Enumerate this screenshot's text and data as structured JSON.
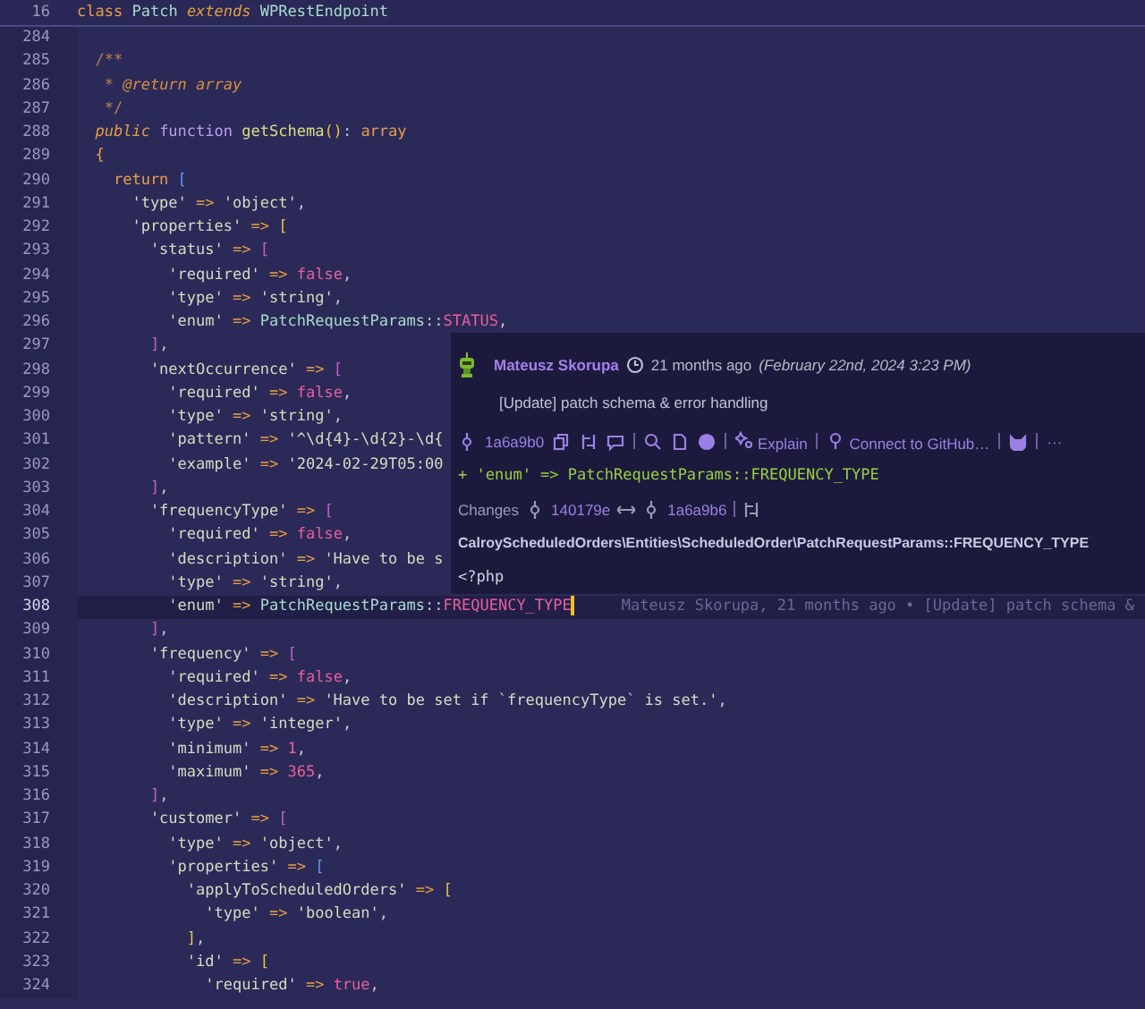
{
  "editor": {
    "sticky_line": {
      "number": "16",
      "tokens": [
        {
          "kind": "keyword",
          "text": "class "
        },
        {
          "kind": "class-name",
          "text": "Patch "
        },
        {
          "kind": "modifier",
          "text": "extends "
        },
        {
          "kind": "class-name",
          "text": "WPRestEndpoint"
        }
      ]
    },
    "lines": [
      {
        "number": "284",
        "current": false
      },
      {
        "number": "285",
        "current": false,
        "tokens": [
          {
            "kind": "comment",
            "text": "  /**"
          }
        ]
      },
      {
        "number": "286",
        "current": false,
        "tokens": [
          {
            "kind": "comment",
            "text": "   * "
          },
          {
            "kind": "doc-tag",
            "text": "@return array"
          }
        ]
      },
      {
        "number": "287",
        "current": false,
        "tokens": [
          {
            "kind": "comment",
            "text": "   */"
          }
        ]
      },
      {
        "number": "288",
        "current": false,
        "tokens": [
          {
            "kind": "modifier",
            "text": "  public "
          },
          {
            "kind": "function-keyword",
            "text": "function "
          },
          {
            "kind": "method",
            "text": "getSchema"
          },
          {
            "kind": "bracket",
            "color": "#e8c040",
            "text": "()"
          },
          {
            "kind": "punctuation",
            "text": ": "
          },
          {
            "kind": "keyword",
            "text": "array"
          }
        ]
      },
      {
        "number": "289",
        "current": false,
        "tokens": [
          {
            "kind": "bracket",
            "color": "#e8a040",
            "text": "  {"
          }
        ]
      },
      {
        "number": "290",
        "current": false,
        "tokens": [
          {
            "kind": "keyword",
            "text": "    return "
          },
          {
            "kind": "bracket",
            "color": "#5a9af0",
            "text": "["
          }
        ]
      },
      {
        "number": "291",
        "current": false,
        "tokens": [
          {
            "kind": "string",
            "text": "      'type'"
          },
          {
            "kind": "operator",
            "text": " => "
          },
          {
            "kind": "string",
            "text": "'object'"
          },
          {
            "kind": "punctuation",
            "text": ","
          }
        ]
      },
      {
        "number": "292",
        "current": false,
        "tokens": [
          {
            "kind": "string",
            "text": "      'properties'"
          },
          {
            "kind": "operator",
            "text": " => "
          },
          {
            "kind": "bracket",
            "color": "#e8c040",
            "text": "["
          }
        ]
      },
      {
        "number": "293",
        "current": false,
        "tokens": [
          {
            "kind": "string",
            "text": "        'status'"
          },
          {
            "kind": "operator",
            "text": " => "
          },
          {
            "kind": "bracket",
            "color": "#c060c8",
            "text": "["
          }
        ]
      },
      {
        "number": "294",
        "current": false,
        "tokens": [
          {
            "kind": "string",
            "text": "          'required'"
          },
          {
            "kind": "operator",
            "text": " => "
          },
          {
            "kind": "literal",
            "text": "false"
          },
          {
            "kind": "punctuation",
            "text": ","
          }
        ]
      },
      {
        "number": "295",
        "current": false,
        "tokens": [
          {
            "kind": "string",
            "text": "          'type'"
          },
          {
            "kind": "operator",
            "text": " => "
          },
          {
            "kind": "string",
            "text": "'string'"
          },
          {
            "kind": "punctuation",
            "text": ","
          }
        ]
      },
      {
        "number": "296",
        "current": false,
        "tokens": [
          {
            "kind": "string",
            "text": "          'enum'"
          },
          {
            "kind": "operator",
            "text": " => "
          },
          {
            "kind": "class-name",
            "text": "PatchRequestParams"
          },
          {
            "kind": "punctuation",
            "text": "::"
          },
          {
            "kind": "constant",
            "text": "STATUS"
          },
          {
            "kind": "punctuation",
            "text": ","
          }
        ]
      },
      {
        "number": "297",
        "current": false,
        "tokens": [
          {
            "kind": "bracket",
            "color": "#c060c8",
            "text": "        ]"
          },
          {
            "kind": "punctuation",
            "text": ","
          }
        ]
      },
      {
        "number": "298",
        "current": false,
        "tokens": [
          {
            "kind": "string",
            "text": "        'nextOccurrence'"
          },
          {
            "kind": "operator",
            "text": " => "
          },
          {
            "kind": "bracket",
            "color": "#c060c8",
            "text": "["
          }
        ]
      },
      {
        "number": "299",
        "current": false,
        "tokens": [
          {
            "kind": "string",
            "text": "          'required'"
          },
          {
            "kind": "operator",
            "text": " => "
          },
          {
            "kind": "literal",
            "text": "false"
          },
          {
            "kind": "punctuation",
            "text": ","
          }
        ]
      },
      {
        "number": "300",
        "current": false,
        "tokens": [
          {
            "kind": "string",
            "text": "          'type'"
          },
          {
            "kind": "operator",
            "text": " => "
          },
          {
            "kind": "string",
            "text": "'string'"
          },
          {
            "kind": "punctuation",
            "text": ","
          }
        ]
      },
      {
        "number": "301",
        "current": false,
        "tokens": [
          {
            "kind": "string",
            "text": "          'pattern'"
          },
          {
            "kind": "operator",
            "text": " => "
          },
          {
            "kind": "string",
            "text": "'^\\d{4}-\\d{2}-\\d{"
          }
        ]
      },
      {
        "number": "302",
        "current": false,
        "tokens": [
          {
            "kind": "string",
            "text": "          'example'"
          },
          {
            "kind": "operator",
            "text": " => "
          },
          {
            "kind": "string",
            "text": "'2024-02-29T05:00"
          }
        ]
      },
      {
        "number": "303",
        "current": false,
        "tokens": [
          {
            "kind": "bracket",
            "color": "#c060c8",
            "text": "        ]"
          },
          {
            "kind": "punctuation",
            "text": ","
          }
        ]
      },
      {
        "number": "304",
        "current": false,
        "tokens": [
          {
            "kind": "string",
            "text": "        'frequencyType'"
          },
          {
            "kind": "operator",
            "text": " => "
          },
          {
            "kind": "bracket",
            "color": "#c060c8",
            "text": "["
          }
        ]
      },
      {
        "number": "305",
        "current": false,
        "tokens": [
          {
            "kind": "string",
            "text": "          'required'"
          },
          {
            "kind": "operator",
            "text": " => "
          },
          {
            "kind": "literal",
            "text": "false"
          },
          {
            "kind": "punctuation",
            "text": ","
          }
        ]
      },
      {
        "number": "306",
        "current": false,
        "tokens": [
          {
            "kind": "string",
            "text": "          'description'"
          },
          {
            "kind": "operator",
            "text": " => "
          },
          {
            "kind": "string",
            "text": "'Have to be s"
          }
        ]
      },
      {
        "number": "307",
        "current": false,
        "tokens": [
          {
            "kind": "string",
            "text": "          'type'"
          },
          {
            "kind": "operator",
            "text": " => "
          },
          {
            "kind": "string",
            "text": "'string'"
          },
          {
            "kind": "punctuation",
            "text": ","
          }
        ]
      },
      {
        "number": "308",
        "current": true,
        "tokens": [
          {
            "kind": "string",
            "text": "          'enum'"
          },
          {
            "kind": "operator",
            "text": " => "
          },
          {
            "kind": "class-name",
            "text": "PatchRequestParams"
          },
          {
            "kind": "punctuation",
            "text": "::"
          },
          {
            "kind": "constant",
            "text": "FREQUENCY_TYPE"
          }
        ]
      },
      {
        "number": "309",
        "current": false,
        "tokens": [
          {
            "kind": "bracket",
            "color": "#c060c8",
            "text": "        ]"
          },
          {
            "kind": "punctuation",
            "text": ","
          }
        ]
      },
      {
        "number": "310",
        "current": false,
        "tokens": [
          {
            "kind": "string",
            "text": "        'frequency'"
          },
          {
            "kind": "operator",
            "text": " => "
          },
          {
            "kind": "bracket",
            "color": "#c060c8",
            "text": "["
          }
        ]
      },
      {
        "number": "311",
        "current": false,
        "tokens": [
          {
            "kind": "string",
            "text": "          'required'"
          },
          {
            "kind": "operator",
            "text": " => "
          },
          {
            "kind": "literal",
            "text": "false"
          },
          {
            "kind": "punctuation",
            "text": ","
          }
        ]
      },
      {
        "number": "312",
        "current": false,
        "tokens": [
          {
            "kind": "string",
            "text": "          'description'"
          },
          {
            "kind": "operator",
            "text": " => "
          },
          {
            "kind": "string",
            "text": "'Have to be set if `frequencyType` is set.'"
          },
          {
            "kind": "punctuation",
            "text": ","
          }
        ]
      },
      {
        "number": "313",
        "current": false,
        "tokens": [
          {
            "kind": "string",
            "text": "          'type'"
          },
          {
            "kind": "operator",
            "text": " => "
          },
          {
            "kind": "string",
            "text": "'integer'"
          },
          {
            "kind": "punctuation",
            "text": ","
          }
        ]
      },
      {
        "number": "314",
        "current": false,
        "tokens": [
          {
            "kind": "string",
            "text": "          'minimum'"
          },
          {
            "kind": "operator",
            "text": " => "
          },
          {
            "kind": "literal",
            "text": "1"
          },
          {
            "kind": "punctuation",
            "text": ","
          }
        ]
      },
      {
        "number": "315",
        "current": false,
        "tokens": [
          {
            "kind": "string",
            "text": "          'maximum'"
          },
          {
            "kind": "operator",
            "text": " => "
          },
          {
            "kind": "literal",
            "text": "365"
          },
          {
            "kind": "punctuation",
            "text": ","
          }
        ]
      },
      {
        "number": "316",
        "current": false,
        "tokens": [
          {
            "kind": "bracket",
            "color": "#c060c8",
            "text": "        ]"
          },
          {
            "kind": "punctuation",
            "text": ","
          }
        ]
      },
      {
        "number": "317",
        "current": false,
        "tokens": [
          {
            "kind": "string",
            "text": "        'customer'"
          },
          {
            "kind": "operator",
            "text": " => "
          },
          {
            "kind": "bracket",
            "color": "#c060c8",
            "text": "["
          }
        ]
      },
      {
        "number": "318",
        "current": false,
        "tokens": [
          {
            "kind": "string",
            "text": "          'type'"
          },
          {
            "kind": "operator",
            "text": " => "
          },
          {
            "kind": "string",
            "text": "'object'"
          },
          {
            "kind": "punctuation",
            "text": ","
          }
        ]
      },
      {
        "number": "319",
        "current": false,
        "tokens": [
          {
            "kind": "string",
            "text": "          'properties'"
          },
          {
            "kind": "operator",
            "text": " => "
          },
          {
            "kind": "bracket",
            "color": "#5a9af0",
            "text": "["
          }
        ]
      },
      {
        "number": "320",
        "current": false,
        "tokens": [
          {
            "kind": "string",
            "text": "            'applyToScheduledOrders'"
          },
          {
            "kind": "operator",
            "text": " => "
          },
          {
            "kind": "bracket",
            "color": "#e8c040",
            "text": "["
          }
        ]
      },
      {
        "number": "321",
        "current": false,
        "tokens": [
          {
            "kind": "string",
            "text": "              'type'"
          },
          {
            "kind": "operator",
            "text": " => "
          },
          {
            "kind": "string",
            "text": "'boolean'"
          },
          {
            "kind": "punctuation",
            "text": ","
          }
        ]
      },
      {
        "number": "322",
        "current": false,
        "tokens": [
          {
            "kind": "bracket",
            "color": "#e8c040",
            "text": "            ]"
          },
          {
            "kind": "punctuation",
            "text": ","
          }
        ]
      },
      {
        "number": "323",
        "current": false,
        "tokens": [
          {
            "kind": "string",
            "text": "            'id'"
          },
          {
            "kind": "operator",
            "text": " => "
          },
          {
            "kind": "bracket",
            "color": "#e8c040",
            "text": "["
          }
        ]
      },
      {
        "number": "324",
        "current": false,
        "tokens": [
          {
            "kind": "string",
            "text": "              'required'"
          },
          {
            "kind": "operator",
            "text": " => "
          },
          {
            "kind": "literal",
            "text": "true"
          },
          {
            "kind": "punctuation",
            "text": ","
          }
        ]
      }
    ],
    "inline_blame": "Mateusz Skorupa, 21 months ago • [Update] patch schema &"
  },
  "blame_popup": {
    "author": "Mateusz Skorupa",
    "time": "21 months ago",
    "date": "(February 22nd, 2024 3:23 PM)",
    "message": "[Update] patch schema & error handling",
    "commit": "1a6a9b0",
    "explain": "Explain",
    "connect": "Connect to GitHub…",
    "more": "···",
    "diff_line": "+ 'enum' => PatchRequestParams::FREQUENCY_TYPE",
    "changes_label": "Changes",
    "from_commit": "140179e",
    "to_commit": "1a6a9b6",
    "symbol_path": "CalroyScheduledOrders\\Entities\\ScheduledOrder\\PatchRequestParams::FREQUENCY_TYPE",
    "code_preview": "<?php"
  }
}
